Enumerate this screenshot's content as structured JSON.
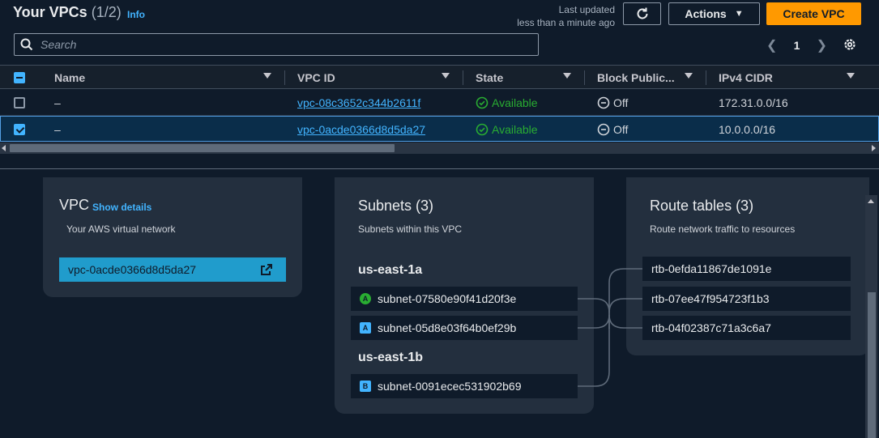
{
  "header": {
    "title": "Your VPCs",
    "count": "(1/2)",
    "info_label": "Info",
    "last_updated_line1": "Last updated",
    "last_updated_line2": "less than a minute ago",
    "actions_label": "Actions",
    "create_label": "Create VPC"
  },
  "search": {
    "placeholder": "Search",
    "value": ""
  },
  "pagination": {
    "current_page": "1"
  },
  "table": {
    "columns": [
      "Name",
      "VPC ID",
      "State",
      "Block Public...",
      "IPv4 CIDR"
    ],
    "rows": [
      {
        "name": "–",
        "vpc_id": "vpc-08c3652c344b2611f",
        "state": "Available",
        "block_public": "Off",
        "ipv4_cidr": "172.31.0.0/16",
        "selected": false
      },
      {
        "name": "–",
        "vpc_id": "vpc-0acde0366d8d5da27",
        "state": "Available",
        "block_public": "Off",
        "ipv4_cidr": "10.0.0.0/16",
        "selected": true
      }
    ]
  },
  "resource_map": {
    "vpc": {
      "title": "VPC",
      "show_details_label": "Show details",
      "subtitle": "Your AWS virtual network",
      "vpc_id": "vpc-0acde0366d8d5da27"
    },
    "subnets": {
      "title": "Subnets (3)",
      "subtitle": "Subnets within this VPC",
      "zones": [
        {
          "name": "us-east-1a",
          "subnets": [
            {
              "badge": "A",
              "id": "subnet-07580e90f41d20f3e",
              "badge_color": "#29ad32"
            },
            {
              "badge": "A",
              "id": "subnet-05d8e03f64b0ef29b",
              "badge_color": "#42b4ff"
            }
          ]
        },
        {
          "name": "us-east-1b",
          "subnets": [
            {
              "badge": "B",
              "id": "subnet-0091ecec531902b69",
              "badge_color": "#42b4ff"
            }
          ]
        }
      ]
    },
    "route_tables": {
      "title": "Route tables (3)",
      "subtitle": "Route network traffic to resources",
      "items": [
        "rtb-0efda11867de1091e",
        "rtb-07ee47f954723f1b3",
        "rtb-04f02387c71a3c6a7"
      ]
    }
  },
  "colors": {
    "accent": "#ff9900",
    "link": "#42b4ff",
    "available": "#29ad32",
    "background": "#0f1b2a",
    "card": "#232f3e"
  }
}
